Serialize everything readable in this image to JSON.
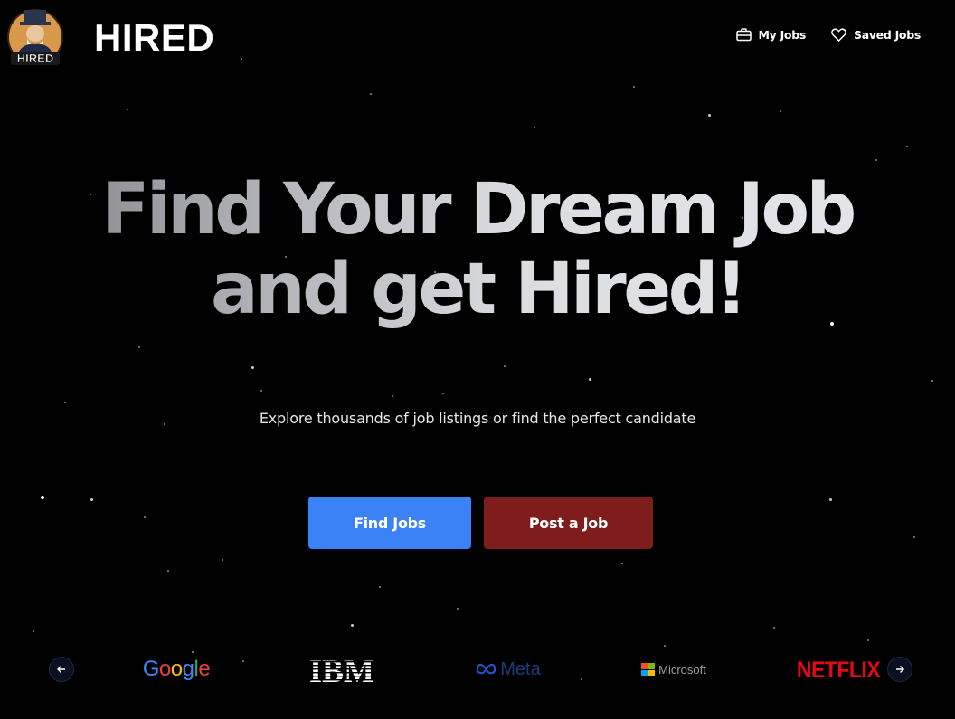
{
  "header": {
    "logo_text": "HIRED",
    "brand": "HIRED",
    "nav": [
      {
        "label": "My Jobs",
        "icon": "briefcase-icon"
      },
      {
        "label": "Saved Jobs",
        "icon": "heart-icon"
      }
    ]
  },
  "hero": {
    "title_line1": "Find Your Dream Job",
    "title_line2": "and get Hired!",
    "subtitle": "Explore thousands of job listings or find the perfect candidate",
    "primary_button": "Find Jobs",
    "secondary_button": "Post a Job"
  },
  "companies": {
    "prev_icon": "arrow-left-icon",
    "next_icon": "arrow-right-icon",
    "logos": [
      "Google",
      "IBM",
      "Meta",
      "Microsoft",
      "NETFLIX"
    ]
  },
  "colors": {
    "background": "#000000",
    "primary_button": "#3b82f6",
    "secondary_button": "#7f1d1d",
    "netflix": "#e50914",
    "google_blue": "#4285f4",
    "google_red": "#ea4335",
    "google_yellow": "#fbbc05",
    "google_green": "#34a853"
  }
}
